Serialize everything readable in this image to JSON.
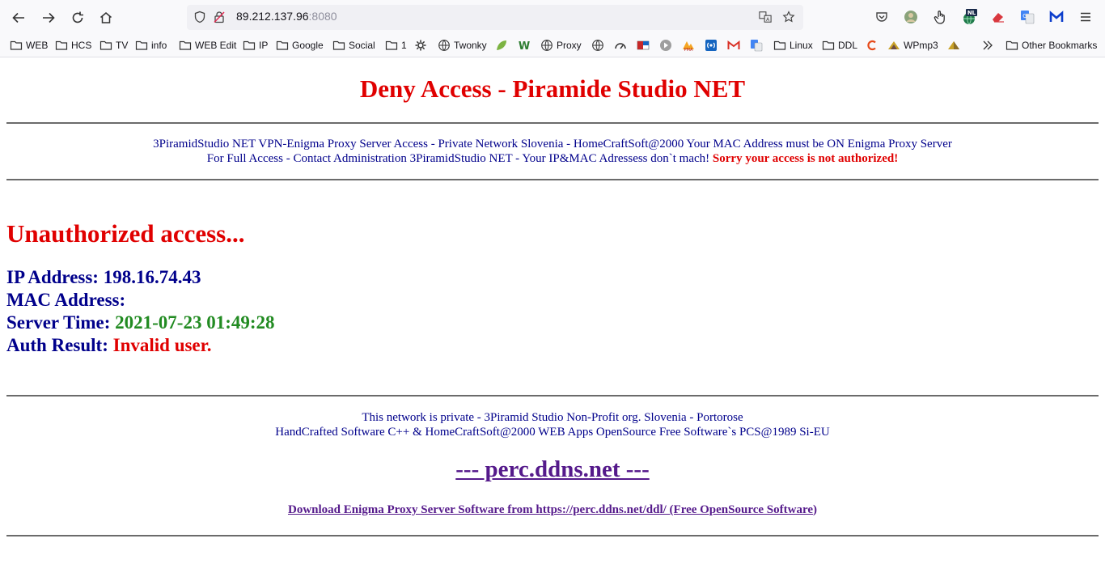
{
  "browser": {
    "url_host": "89.212.137.96",
    "url_port": ":8080",
    "bookmarks": [
      {
        "label": "WEB",
        "icon": "folder-icon"
      },
      {
        "label": "HCS",
        "icon": "folder-icon"
      },
      {
        "label": "TV",
        "icon": "folder-icon"
      },
      {
        "label": "info",
        "icon": "folder-icon"
      },
      {
        "label": "WEB Edit",
        "icon": "folder-icon"
      },
      {
        "label": "IP",
        "icon": "folder-icon"
      },
      {
        "label": "Google",
        "icon": "folder-icon"
      },
      {
        "label": "Social",
        "icon": "folder-icon"
      },
      {
        "label": "1",
        "icon": "folder-icon"
      },
      {
        "label": "Twonky",
        "icon": "globe-icon"
      },
      {
        "label": "Proxy",
        "icon": "globe-icon"
      },
      {
        "label": "Linux",
        "icon": "folder-icon"
      },
      {
        "label": "DDL",
        "icon": "folder-icon"
      },
      {
        "label": "WPmp3",
        "icon": "wp-icon"
      },
      {
        "label": "Other Bookmarks",
        "icon": "folder-icon"
      }
    ],
    "badge": "NL"
  },
  "page": {
    "title": "Deny Access - Piramide Studio NET",
    "info_line1": "3PiramidStudio NET VPN-Enigma Proxy Server Access - Private Network Slovenia - HomeCraftSoft@2000 Your MAC Address must be ON Enigma Proxy Server",
    "info_line2": "For Full Access - Contact Administration 3PiramidStudio NET - Your IP&MAC Adressess don`t mach!",
    "info_warning": "Sorry your access is not authorized!",
    "heading": "Unauthorized access...",
    "ip_label": "IP Address:",
    "ip_value": "198.16.74.43",
    "mac_label": "MAC Address:",
    "mac_value": "",
    "time_label": "Server Time:",
    "time_value": "2021-07-23 01:49:28",
    "auth_label": "Auth Result:",
    "auth_value": "Invalid user.",
    "footer_line1": "This network is private - 3Piramid Studio Non-Profit org. Slovenia - Portorose",
    "footer_line2": "HandCrafted Software C++ & HomeCraftSoft@2000 WEB Apps OpenSource Free Software`s PCS@1989 Si-EU",
    "site_link": "--- perc.ddns.net ---",
    "download_link": "Download Enigma Proxy Server Software from https://perc.ddns.net/ddl/ (Free OpenSource Software",
    "download_close": ")"
  },
  "colors": {
    "title_red": "#e00000",
    "text_blue": "#00008b",
    "time_green": "#228b22",
    "link_purple": "#551a8b"
  }
}
